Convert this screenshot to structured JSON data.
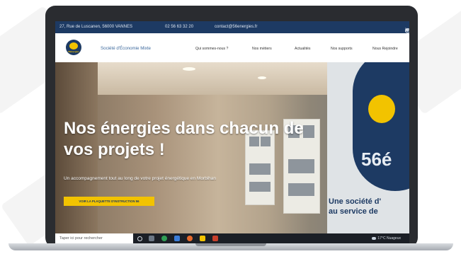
{
  "topbar": {
    "address": "27, Rue de Luscanen, 56000 VANNES",
    "phone": "02 56 63 32 20",
    "email": "contact@56energies.fr",
    "social": [
      "in",
      "twitter-icon",
      "instagram-icon"
    ]
  },
  "header": {
    "logo_text": "56énergies",
    "brand": "Société d'Économie Mixte",
    "nav": [
      "Qui sommes-nous ?",
      "Nos métiers",
      "Actualités",
      "Nos supports",
      "Nous Rejoindre"
    ]
  },
  "hero": {
    "headline_1": "Nos énergies dans chacun de",
    "headline_2": "vos projets !",
    "subline": "Un accompagnement tout au long de votre projet énergétique en Morbihan",
    "cta": "VOIR LA PLAQUETTE D'INSTRUCTION 56",
    "sign_1": "Une société d'",
    "sign_2": "au service de",
    "sign_number": "56é"
  },
  "taskbar": {
    "search_placeholder": "Taper ici pour rechercher",
    "weather": "17°C Nuageux"
  },
  "colors": {
    "navy": "#1d3a63",
    "yellow": "#f2c300",
    "brand_blue": "#3e6a9e"
  }
}
